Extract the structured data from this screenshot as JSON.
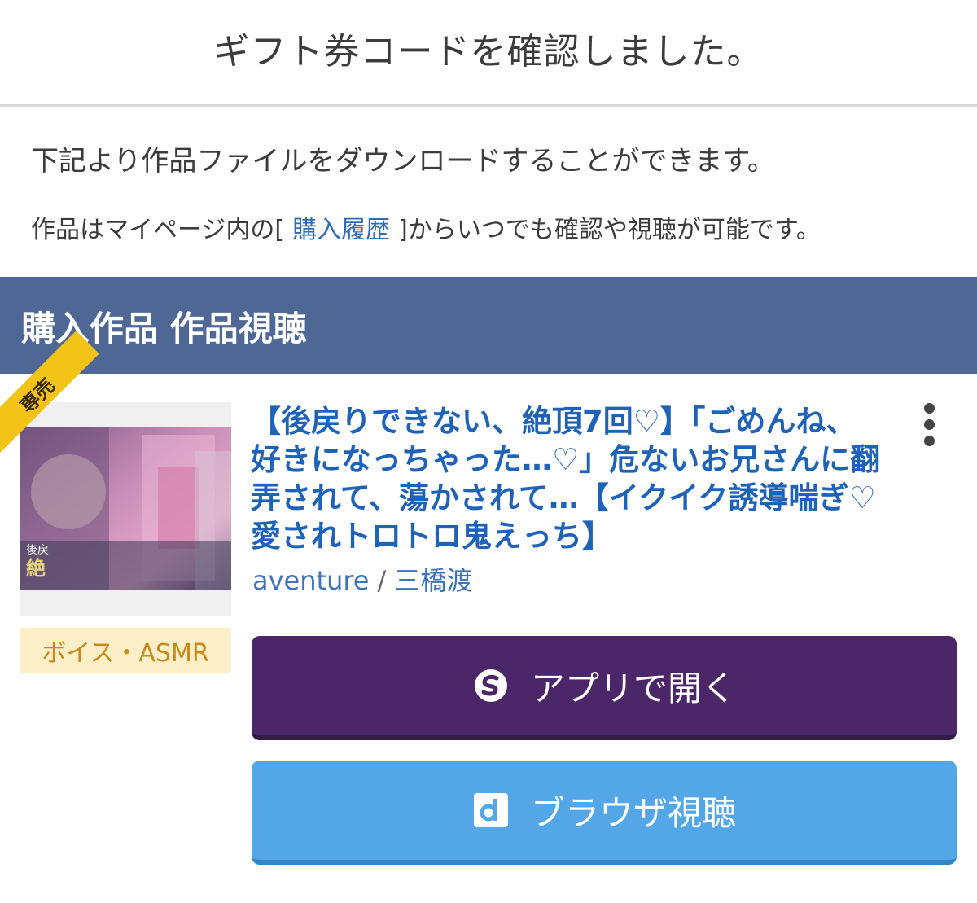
{
  "header": {
    "title": "ギフト券コードを確認しました。"
  },
  "messages": {
    "download_text": "下記より作品ファイルをダウンロードすることができます。",
    "mypage_prefix": "作品はマイページ内の[",
    "mypage_link": "購入履歴",
    "mypage_suffix": "]からいつでも確認や視聴が可能です。"
  },
  "section": {
    "title": "購入作品 作品視聴"
  },
  "product": {
    "badge": "専売",
    "category": "ボイス・ASMR",
    "title": "【後戻りできない、絶頂7回♡】「ごめんね、好きになっちゃった…♡」危ないお兄さんに翻弄されて、蕩かされて…【イクイク誘導喘ぎ♡愛されトロトロ鬼えっち】",
    "circle": "aventure",
    "separator": "/",
    "voice_actor": "三橋渡",
    "thumbnail_text_1": "後戻",
    "thumbnail_text_2": "絶"
  },
  "buttons": {
    "open_app": "アプリで開く",
    "browser_view": "ブラウザ視聴"
  },
  "icons": {
    "more": "more-vertical-icon",
    "app": "app-logo-icon",
    "browser": "d-logo-icon"
  },
  "colors": {
    "section_bar": "#4f6794",
    "link": "#1f63b8",
    "app_button": "#4b2669",
    "browser_button": "#53a7e6",
    "badge": "#f3c317",
    "category_bg": "#fcefc8",
    "category_text": "#c98a1a"
  }
}
